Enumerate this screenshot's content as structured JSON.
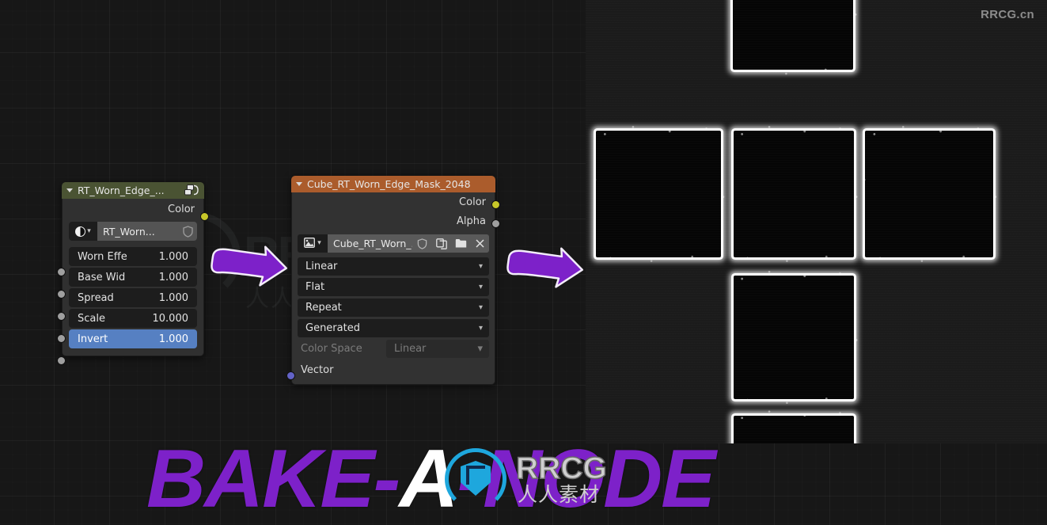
{
  "app": {
    "editor": "blender-shader-node-editor",
    "background_color": "#171717",
    "grid_color": "#202020"
  },
  "watermarks": {
    "top_right": "RRCG.cn",
    "background_logo_text": "RRCG",
    "background_logo_sub": "人人素材"
  },
  "nodes": [
    {
      "id": "node-group",
      "header_label": "RT_Worn_Edge_...",
      "header_color": "#4a5333",
      "header_icon": "node-group-icon",
      "outputs": [
        {
          "label": "Color",
          "socket_color": "#c7c729"
        }
      ],
      "datablock": {
        "icon": "node-group-icon",
        "dropdown_icon": "chevron-down-icon",
        "name": "RT_Worn...",
        "fake_user_icon": "shield-icon"
      },
      "properties": [
        {
          "label": "Worn Effe",
          "value": "1.000",
          "style": "field"
        },
        {
          "label": "Base Wid",
          "value": "1.000",
          "style": "field"
        },
        {
          "label": "Spread",
          "value": "1.000",
          "style": "field"
        },
        {
          "label": "Scale",
          "value": "10.000",
          "style": "field"
        },
        {
          "label": "Invert",
          "value": "1.000",
          "style": "slider"
        }
      ],
      "input_socket_color": "#9f9f9f",
      "slider_color": "#5680c2"
    },
    {
      "id": "node-image-texture",
      "header_label": "Cube_RT_Worn_Edge_Mask_2048",
      "header_color": "#ab5c2c",
      "outputs": [
        {
          "label": "Color",
          "socket_color": "#c7c729"
        },
        {
          "label": "Alpha",
          "socket_color": "#9f9f9f"
        }
      ],
      "datablock": {
        "icon": "image-icon",
        "dropdown_icon": "chevron-down-icon",
        "name": "Cube_RT_Worn_...",
        "buttons": [
          {
            "icon": "shield-icon",
            "name": "fake-user-button"
          },
          {
            "icon": "copy-icon",
            "name": "new-image-button"
          },
          {
            "icon": "folder-icon",
            "name": "open-image-button"
          },
          {
            "icon": "close-icon",
            "name": "unlink-image-button"
          }
        ]
      },
      "dropdowns": [
        {
          "name": "interpolation",
          "value": "Linear"
        },
        {
          "name": "projection",
          "value": "Flat"
        },
        {
          "name": "extension",
          "value": "Repeat"
        },
        {
          "name": "source",
          "value": "Generated"
        }
      ],
      "color_space": {
        "label": "Color Space",
        "value": "Linear",
        "disabled": true
      },
      "inputs": [
        {
          "label": "Vector",
          "socket_color": "#6363c7"
        }
      ]
    }
  ],
  "arrows": [
    {
      "name": "arrow-group-to-texture",
      "color": "#7d21c9",
      "outline": "#f0e6f8",
      "direction": "right"
    },
    {
      "name": "arrow-texture-to-result",
      "color": "#7d21c9",
      "outline": "#f0e6f8",
      "direction": "right"
    }
  ],
  "uv_preview": {
    "name": "cube-uv-cross-worn-edge-mask",
    "description": "Cube UV cross layout with worn-edge mask baked: black faces with white grungy borders",
    "faces": 6,
    "edge_color": "#ffffff",
    "face_color": "#050505"
  },
  "banner": {
    "title_part1": "BAKE-",
    "title_part_white": "A",
    "title_part2": "-NODE",
    "color": "#7d21c9",
    "accent_color": "#ffffff",
    "logo": {
      "brand": "RRCG",
      "sub": "人人素材",
      "ring_color": "#1ea7dd"
    }
  }
}
